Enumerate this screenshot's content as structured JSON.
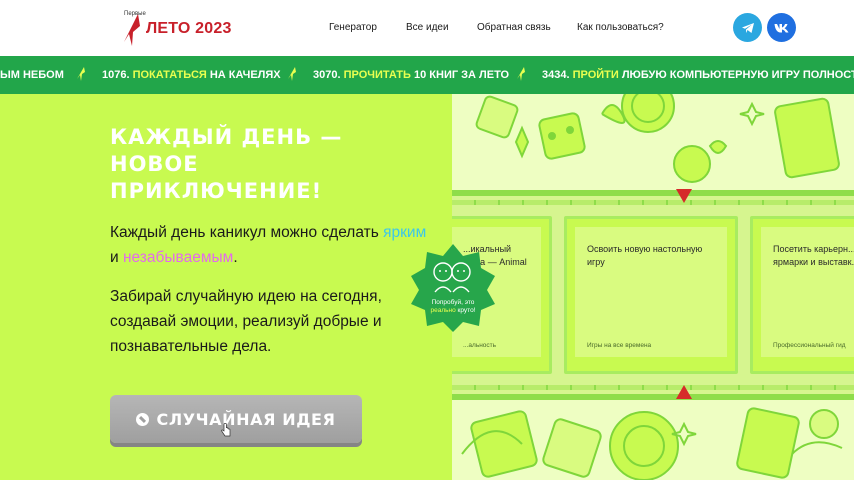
{
  "header": {
    "logo_small": "Первые",
    "logo_text": "ЛЕТО 2023",
    "nav": [
      {
        "label": "Генератор"
      },
      {
        "label": "Все идеи"
      },
      {
        "label": "Обратная связь"
      },
      {
        "label": "Как пользоваться?"
      }
    ],
    "social": [
      {
        "icon": "telegram-icon",
        "color": "#2aa7e0"
      },
      {
        "icon": "vk-icon",
        "color": "#1f6fe0"
      }
    ]
  },
  "ticker": {
    "background": "#22a64a",
    "highlight_color": "#e9ff50",
    "items": [
      {
        "prefix": "",
        "highlight": "",
        "rest": "ЫМ НЕБОМ"
      },
      {
        "prefix": "1076. ",
        "highlight": "ПОКАТАТЬСЯ",
        "rest": " НА КАЧЕЛЯХ"
      },
      {
        "prefix": "3070. ",
        "highlight": "ПРОЧИТАТЬ",
        "rest": " 10 КНИГ ЗА ЛЕТО"
      },
      {
        "prefix": "3434. ",
        "highlight": "ПРОЙТИ",
        "rest": " ЛЮБУЮ КОМПЬЮТЕРНУЮ ИГРУ ПОЛНОСТЬЮ"
      }
    ]
  },
  "hero": {
    "title_lines": [
      "КАЖДЫЙ ДЕНЬ —",
      "НОВОЕ",
      "ПРИКЛЮЧЕНИЕ!"
    ],
    "subtitle_part1": "Каждый день каникул можно сделать ",
    "subtitle_bright": "ярким",
    "subtitle_and": " и ",
    "subtitle_memorable": "незабываемым",
    "subtitle_end": ".",
    "body": "Забирай случайную идею на сегодня, создавай эмоции, реализуй добрые и познавательные дела.",
    "button_label": "СЛУЧАЙНАЯ ИДЕЯ",
    "colors": {
      "background": "#c8fa50",
      "bright": "#3cc7ea",
      "memorable": "#e36bea"
    }
  },
  "cards": [
    {
      "title": "...икальный\n...ова — Animal\n...rons",
      "category": "...альность"
    },
    {
      "title": "Освоить новую настольную\nигру",
      "category": "Игры на все времена"
    },
    {
      "title": "Посетить карьерн...\nярмарки и выставк...",
      "category": "Профессиональный гид"
    }
  ],
  "badge": {
    "line1": "Попробуй, это",
    "highlight": "реально",
    "line2_rest": " круто!"
  }
}
